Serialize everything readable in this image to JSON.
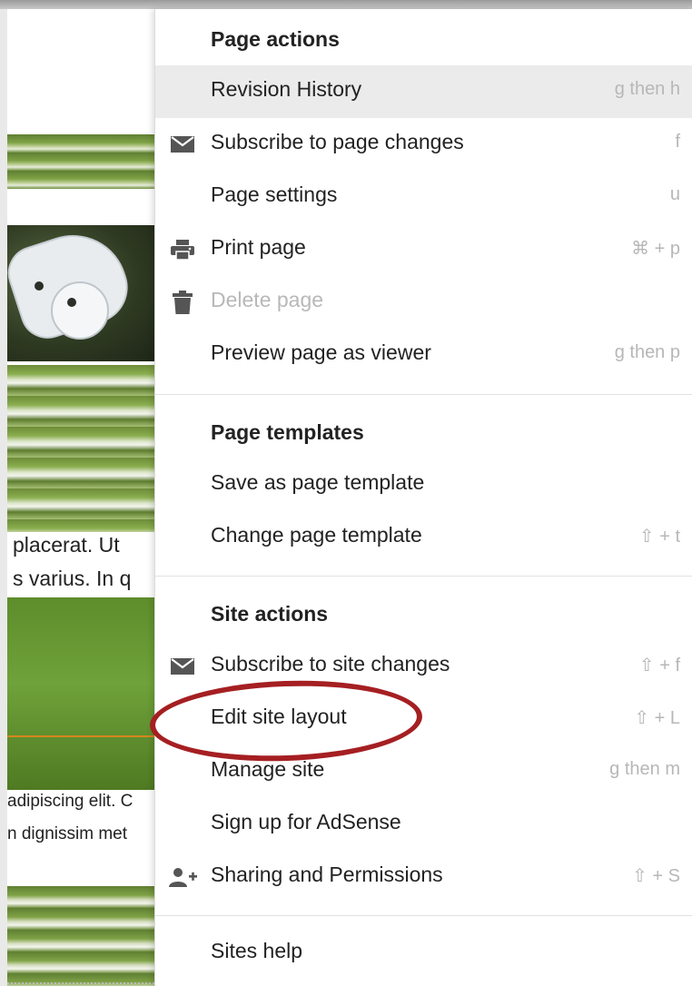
{
  "background_page": {
    "text_lines_1": [
      "placerat. Ut",
      "s varius. In q"
    ],
    "text_lines_2": [
      "adipiscing elit. C",
      "n dignissim met"
    ]
  },
  "menu": {
    "sections": {
      "page_actions": "Page actions",
      "page_templates": "Page templates",
      "site_actions": "Site actions"
    },
    "items": {
      "revision_history": {
        "label": "Revision History",
        "shortcut": "g then h"
      },
      "subscribe_page": {
        "label": "Subscribe to page changes",
        "shortcut": "f",
        "icon": "envelope-icon"
      },
      "page_settings": {
        "label": "Page settings",
        "shortcut": "u"
      },
      "print_page": {
        "label": "Print page",
        "shortcut": "⌘ + p",
        "icon": "printer-icon"
      },
      "delete_page": {
        "label": "Delete page",
        "shortcut": "",
        "icon": "trash-icon"
      },
      "preview_page": {
        "label": "Preview page as viewer",
        "shortcut": "g then p"
      },
      "save_template": {
        "label": "Save as page template",
        "shortcut": ""
      },
      "change_template": {
        "label": "Change page template",
        "shortcut": "⇧ + t"
      },
      "subscribe_site": {
        "label": "Subscribe to site changes",
        "shortcut": "⇧ + f",
        "icon": "envelope-icon"
      },
      "edit_layout": {
        "label": "Edit site layout",
        "shortcut": "⇧ + L"
      },
      "manage_site": {
        "label": "Manage site",
        "shortcut": "g then m"
      },
      "adsense": {
        "label": "Sign up for AdSense",
        "shortcut": ""
      },
      "sharing": {
        "label": "Sharing and Permissions",
        "shortcut": "⇧ + S",
        "icon": "add-person-icon"
      },
      "sites_help": {
        "label": "Sites help",
        "shortcut": ""
      }
    }
  },
  "colors": {
    "highlight": "#ebebeb",
    "annotation_ellipse": "#a51f22",
    "shortcut_text": "#b7b7b7"
  }
}
